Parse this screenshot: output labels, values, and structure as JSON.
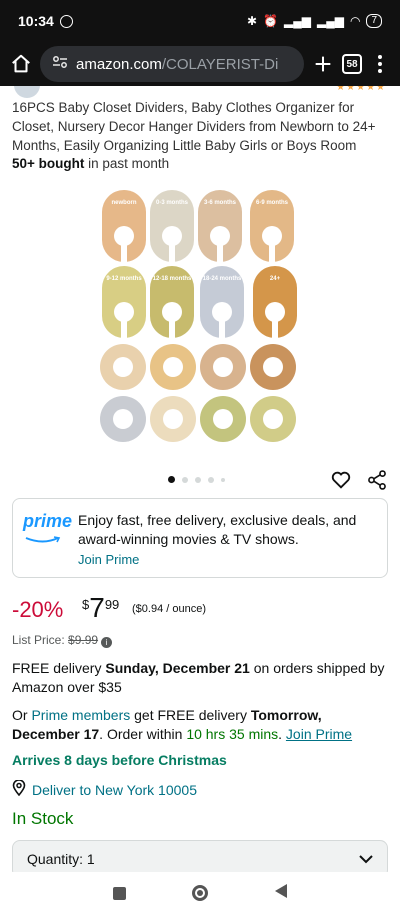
{
  "status_bar": {
    "time": "10:34",
    "battery": "7"
  },
  "browser": {
    "url_host": "amazon.com",
    "url_path": "/COLAYERIST-Di",
    "tabs_count": "58"
  },
  "product": {
    "title": "16PCS Baby Closet Dividers, Baby Clothes Organizer for Closet, Nursery Decor Hanger Dividers from Newborn to 24+ Months, Easily Organizing Little Baby Girls or Boys Room",
    "bought_bold": "50+ bought",
    "bought_rest": " in past month",
    "hanger_labels": [
      "newborn",
      "0-3 months",
      "3-6 months",
      "6-9 months",
      "9-12 months",
      "12-18 months",
      "18-24 months",
      "24+"
    ]
  },
  "carousel": {
    "count": 5,
    "active": 0
  },
  "prime": {
    "logo": "prime",
    "text": "Enjoy fast, free delivery, exclusive deals, and award-winning movies & TV shows.",
    "join_label": "Join Prime"
  },
  "price": {
    "discount": "-20%",
    "symbol": "$",
    "whole": "7",
    "fraction": "99",
    "unit_price": "($0.94 / ounce)",
    "list_label": "List Price: ",
    "list_value": "$9.99"
  },
  "delivery": {
    "line1_a": "FREE delivery ",
    "line1_date": "Sunday, December 21",
    "line1_b": " on orders shipped by Amazon over $35",
    "line2_a": "Or ",
    "line2_link": "Prime members",
    "line2_b": " get FREE delivery ",
    "line2_date": "Tomorrow, December 17",
    "line2_c": ". Order within ",
    "line2_time": "10 hrs 35 mins",
    "line2_d": ". ",
    "line2_join": "Join Prime",
    "arrives": "Arrives 8 days before Christmas",
    "deliver_to": "Deliver to New York 10005",
    "stock": "In Stock"
  },
  "quantity": {
    "label": "Quantity:",
    "value": "1"
  },
  "colors": {
    "link": "#007185",
    "discount": "#cc0c39",
    "in_stock": "#007600",
    "prime_blue": "#1a98ff"
  }
}
